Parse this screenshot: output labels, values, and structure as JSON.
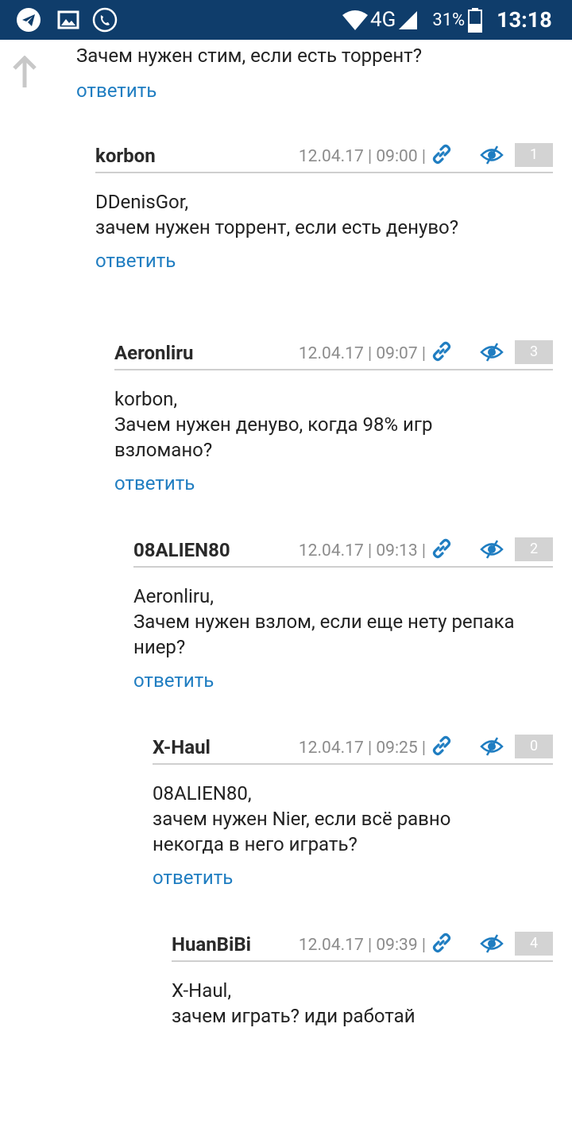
{
  "status_bar": {
    "network": "4G",
    "battery": "31%",
    "time": "13:18"
  },
  "top_comment": {
    "text": "Зачем нужен стим, если есть торрент?",
    "reply_label": "ответить"
  },
  "comments": [
    {
      "author": "korbon",
      "date": "12.04.17",
      "time": "09:00",
      "votes": "1",
      "body": "DDenisGor,\nзачем нужен торрент, если есть денуво?",
      "reply_label": "ответить"
    },
    {
      "author": "Aeronliru",
      "date": "12.04.17",
      "time": "09:07",
      "votes": "3",
      "body": "korbon,\nЗачем нужен денуво, когда 98% игр\nвзломано?",
      "reply_label": "ответить"
    },
    {
      "author": "08ALIEN80",
      "date": "12.04.17",
      "time": "09:13",
      "votes": "2",
      "body": "Aeronliru,\nЗачем нужен взлом, если еще нету репака\nниер?",
      "reply_label": "ответить"
    },
    {
      "author": "X-Haul",
      "date": "12.04.17",
      "time": "09:25",
      "votes": "0",
      "body": "08ALIEN80,\nзачем нужен Nier, если всё равно\nнекогда в него играть?",
      "reply_label": "ответить"
    },
    {
      "author": "HuanBiBi",
      "date": "12.04.17",
      "time": "09:39",
      "votes": "4",
      "body": "X-Haul,\nзачем играть? иди работай",
      "reply_label": ""
    }
  ],
  "colors": {
    "status_bar": "#0f3d6b",
    "link": "#1f7dc1",
    "vote_badge": "#d3d3d3"
  },
  "icons": [
    "telegram-icon",
    "gallery-icon",
    "phone-icon",
    "wifi-icon",
    "signal-icon",
    "battery-icon",
    "up-arrow-icon",
    "link-icon",
    "hide-eye-icon"
  ]
}
